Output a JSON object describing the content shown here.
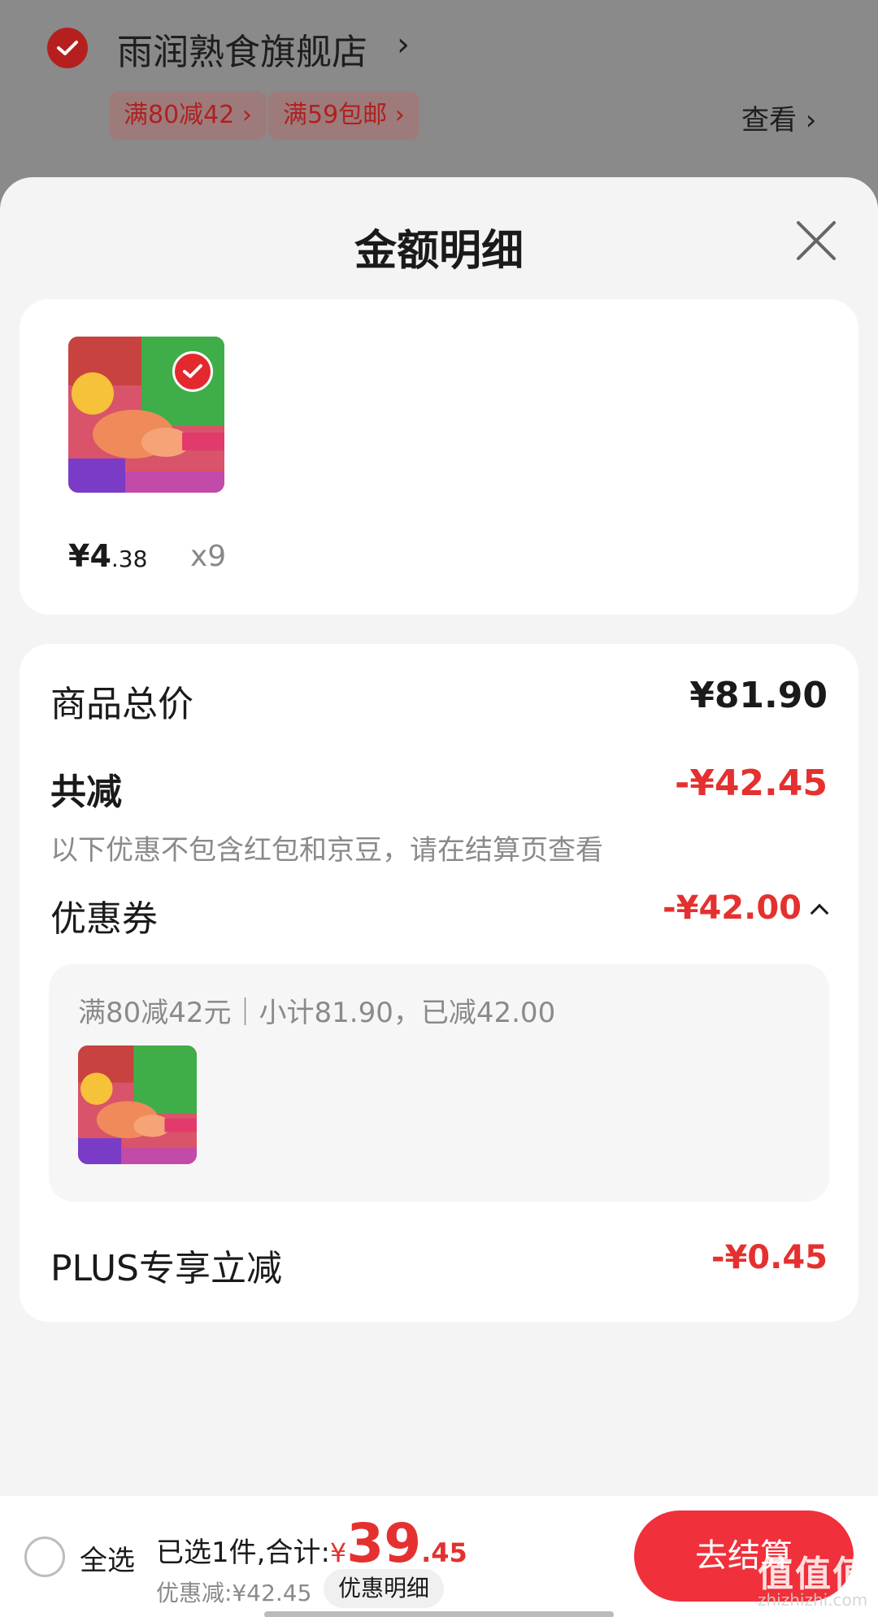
{
  "store": {
    "name": "雨润熟食旗舰店",
    "arrow": "›",
    "promo_tags": [
      "满80减42 ›",
      "满59包邮 ›"
    ],
    "view_label": "查看 ›"
  },
  "sheet": {
    "title": "金额明细"
  },
  "items": {
    "price_int": "¥4",
    "price_dec": ".38",
    "quantity": "x9"
  },
  "detail": {
    "goods_total_label": "商品总价",
    "goods_total_value": "¥81.90",
    "total_reduction_label": "共减",
    "total_reduction_value": "-¥42.45",
    "reduction_note": "以下优惠不包含红包和京豆，请在结算页查看",
    "coupon_label": "优惠券",
    "coupon_value": "-¥42.00",
    "coupon_detail": "满80减42元｜小计81.90，已减42.00",
    "plus_label": "PLUS专享立减",
    "plus_value": "-¥0.45"
  },
  "bottom_bar": {
    "select_all_label": "全选",
    "selected_prefix": "已选1件,合计:",
    "total_currency": "¥",
    "total_int": "39",
    "total_dec": ".45",
    "discount_text": "优惠减:¥42.45",
    "discount_detail_button": "优惠明细",
    "checkout_button": "去结算"
  },
  "watermark": {
    "text": "值值值",
    "sub": "zhizhizhi.com"
  },
  "colors": {
    "accent_red": "#e4312f",
    "checkout_red": "#f0303a"
  }
}
